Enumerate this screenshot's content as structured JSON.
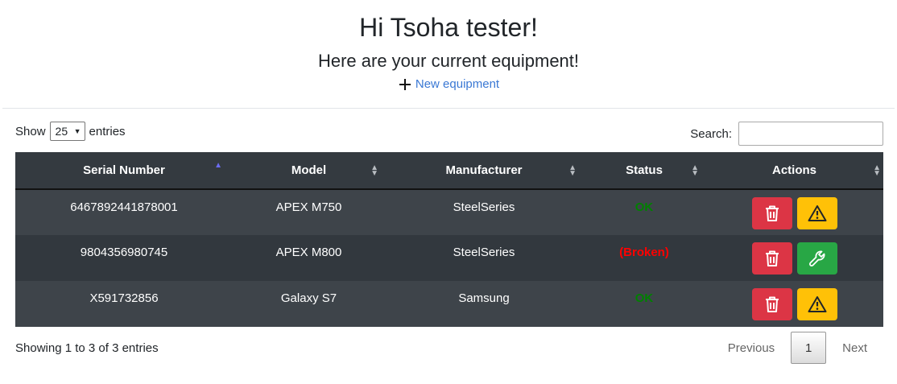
{
  "header": {
    "greeting": "Hi Tsoha tester!",
    "subtitle": "Here are your current equipment!",
    "new_link": "New equipment"
  },
  "controls": {
    "show_label": "Show",
    "entries_label": "entries",
    "page_length": "25",
    "search_label": "Search:",
    "search_value": ""
  },
  "table": {
    "columns": [
      "Serial Number",
      "Model",
      "Manufacturer",
      "Status",
      "Actions"
    ],
    "sorted_column": "Serial Number",
    "sort_direction": "ascending",
    "rows": [
      {
        "serial": "6467892441878001",
        "model": "APEX M750",
        "manufacturer": "SteelSeries",
        "status": "OK",
        "action_icon": "warning-icon"
      },
      {
        "serial": "9804356980745",
        "model": "APEX M800",
        "manufacturer": "SteelSeries",
        "status": "(Broken)",
        "action_icon": "wrench-icon"
      },
      {
        "serial": "X591732856",
        "model": "Galaxy S7",
        "manufacturer": "Samsung",
        "status": "OK",
        "action_icon": "warning-icon"
      }
    ]
  },
  "footer": {
    "info": "Showing 1 to 3 of 3 entries",
    "previous": "Previous",
    "current_page": "1",
    "next": "Next"
  },
  "colors": {
    "table_header_bg": "#343a40",
    "row_odd_bg": "#3e444a",
    "row_even_bg": "#32383e",
    "status_ok": "#008000",
    "status_broken": "#ff0000",
    "delete_button": "#dc3545",
    "report_button": "#ffc107",
    "repair_button": "#28a745",
    "link": "#3a78d4"
  }
}
